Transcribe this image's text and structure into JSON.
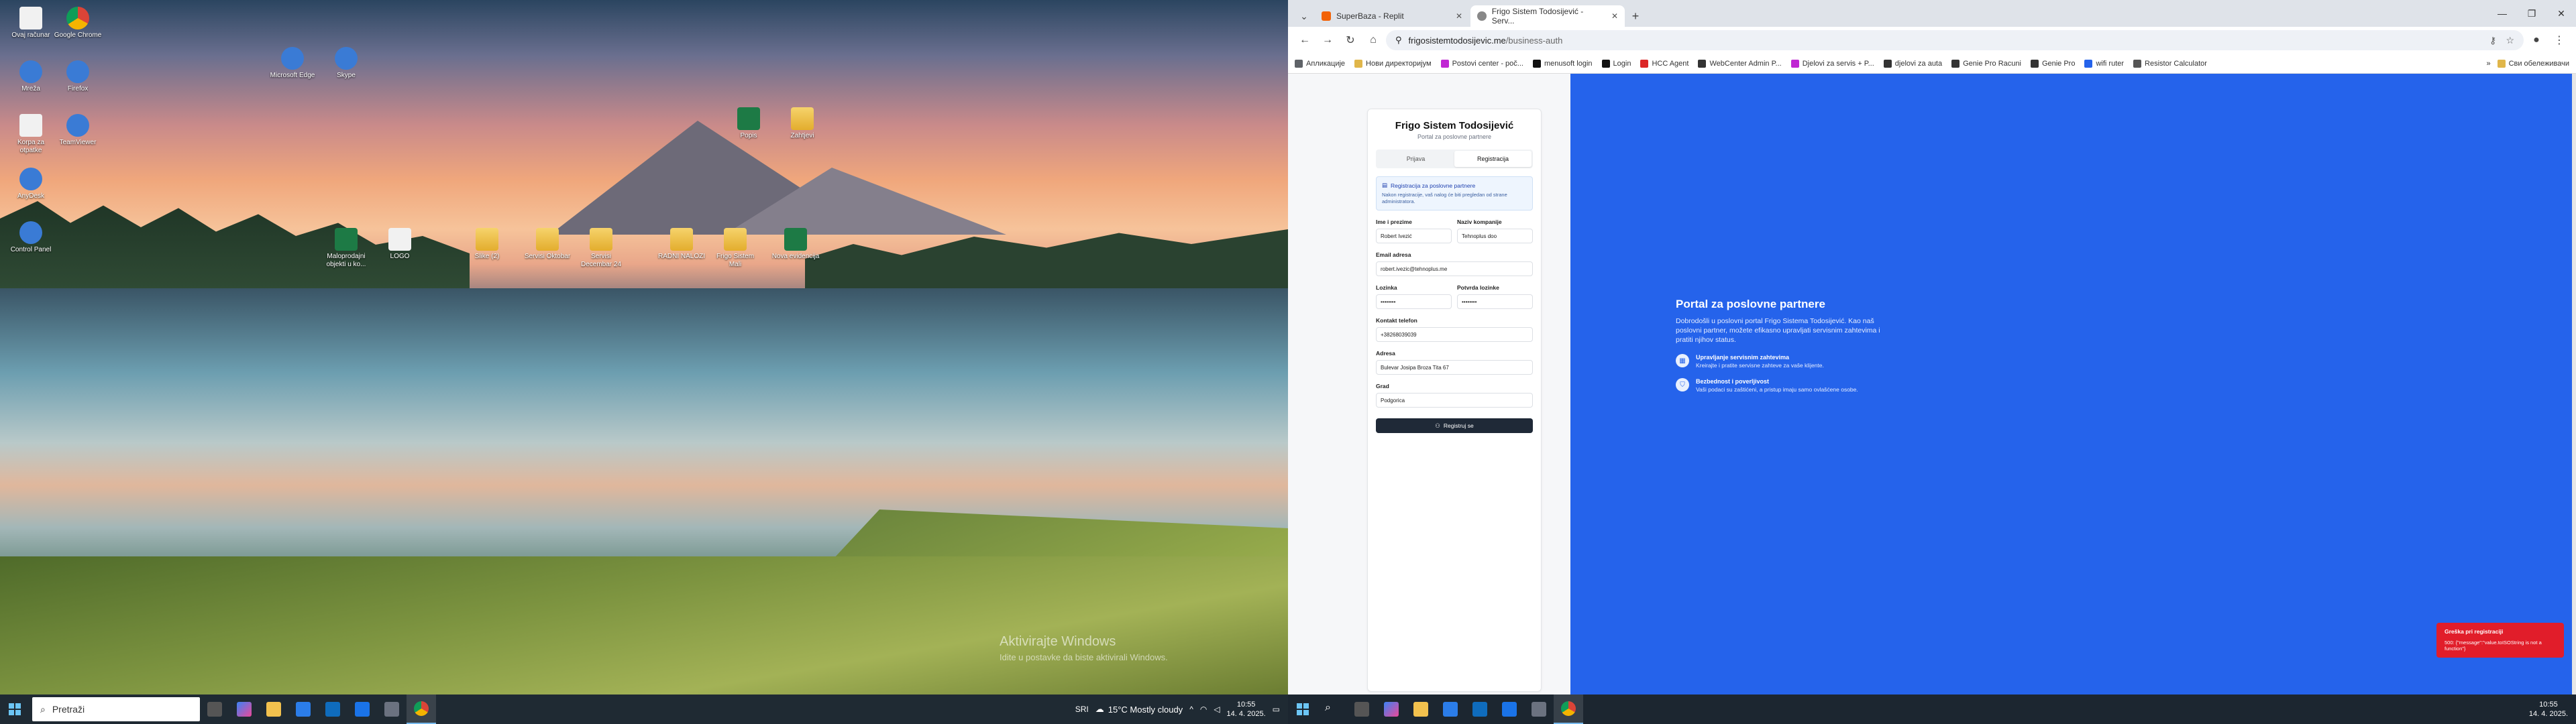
{
  "desktop": {
    "icons": [
      {
        "label": "Ovaj računar",
        "kind": "doc"
      },
      {
        "label": "Mreža",
        "kind": "app"
      },
      {
        "label": "Korpa za otpatke",
        "kind": "doc"
      },
      {
        "label": "AnyDesk",
        "kind": "app"
      },
      {
        "label": "Control Panel",
        "kind": "app"
      },
      {
        "label": "Google Chrome",
        "kind": "ch"
      },
      {
        "label": "Firefox",
        "kind": "app"
      },
      {
        "label": "TeamViewer",
        "kind": "app"
      },
      {
        "label": "Microsoft Edge",
        "kind": "app"
      },
      {
        "label": "Skype",
        "kind": "app"
      },
      {
        "label": "Maloprodajni objekti u ko...",
        "kind": "xl"
      },
      {
        "label": "LOGO",
        "kind": "doc"
      },
      {
        "label": "Slike (2)",
        "kind": "fd"
      },
      {
        "label": "Servisi Oktobar",
        "kind": "fd"
      },
      {
        "label": "Servisi Decembar 24",
        "kind": "fd"
      },
      {
        "label": "RADNI NALOZI",
        "kind": "fd"
      },
      {
        "label": "Frigo Sistem Mali",
        "kind": "fd"
      },
      {
        "label": "Nova evidencija",
        "kind": "xl"
      },
      {
        "label": "Zahtjevi",
        "kind": "fd"
      },
      {
        "label": "Popis",
        "kind": "xl"
      }
    ],
    "watermark_title": "Aktivirajte Windows",
    "watermark_sub": "Idite u postavke da biste aktivirali Windows."
  },
  "taskbar_left": {
    "search_placeholder": "Pretraži",
    "weather": "15°C  Mostly cloudy",
    "lang": "SRI",
    "time": "10:55",
    "date": "14. 4. 2025."
  },
  "taskbar_right": {
    "time": "10:55",
    "date": "14. 4. 2025."
  },
  "browser": {
    "tabs": [
      {
        "title": "SuperBaza - Replit",
        "active": false
      },
      {
        "title": "Frigo Sistem Todosijević - Serv...",
        "active": true
      }
    ],
    "url_host": "frigosistemtodosijevic.me",
    "url_path": "/business-auth",
    "bookmarks": [
      "Апликације",
      "Нови директоријум",
      "Postovi center - poč...",
      "menusoft login",
      "Login",
      "HCC Agent",
      "WebCenter Admin P...",
      "Djelovi za servis + P...",
      "djelovi za auta",
      "Genie Pro Racuni",
      "Genie Pro",
      "wifi ruter",
      "Resistor Calculator"
    ],
    "bookmarks_other": "Сви обележивачи"
  },
  "form": {
    "title": "Frigo Sistem Todosijević",
    "subtitle": "Portal za poslovne partnere",
    "tab_login": "Prijava",
    "tab_register": "Registracija",
    "info_title": "Registracija za poslovne partnere",
    "info_desc": "Nakon registracije, vaš nalog će biti pregledan od strane administratora.",
    "name_label": "Ime i prezime",
    "name_value": "Robert Ivezić",
    "company_label": "Naziv kompanije",
    "company_value": "Tehnoplus doo",
    "email_label": "Email adresa",
    "email_value": "robert.ivezic@tehnoplus.me",
    "password_label": "Lozinka",
    "password_value": "••••••••",
    "confirm_label": "Potvrda lozinke",
    "confirm_value": "••••••••",
    "phone_label": "Kontakt telefon",
    "phone_value": "+38268039039",
    "address_label": "Adresa",
    "address_value": "Bulevar Josipa Broza Tita 67",
    "city_label": "Grad",
    "city_value": "Podgorica",
    "submit_label": "Registruj se"
  },
  "hero": {
    "title": "Portal za poslovne partnere",
    "desc": "Dobrodošli u poslovni portal Frigo Sistema Todosijević. Kao naš poslovni partner, možete efikasno upravljati servisnim zahtevima i pratiti njihov status.",
    "f1_title": "Upravljanje servisnim zahtevima",
    "f1_desc": "Kreirajte i pratite servisne zahteve za vaše klijente.",
    "f2_title": "Bezbednost i poverljivost",
    "f2_desc": "Vaši podaci su zaštićeni, a pristup imaju samo ovlašćene osobe."
  },
  "toast": {
    "title": "Greška pri registraciji",
    "message": "500: {\"message\":\"value.toISOString is not a function\"}"
  }
}
